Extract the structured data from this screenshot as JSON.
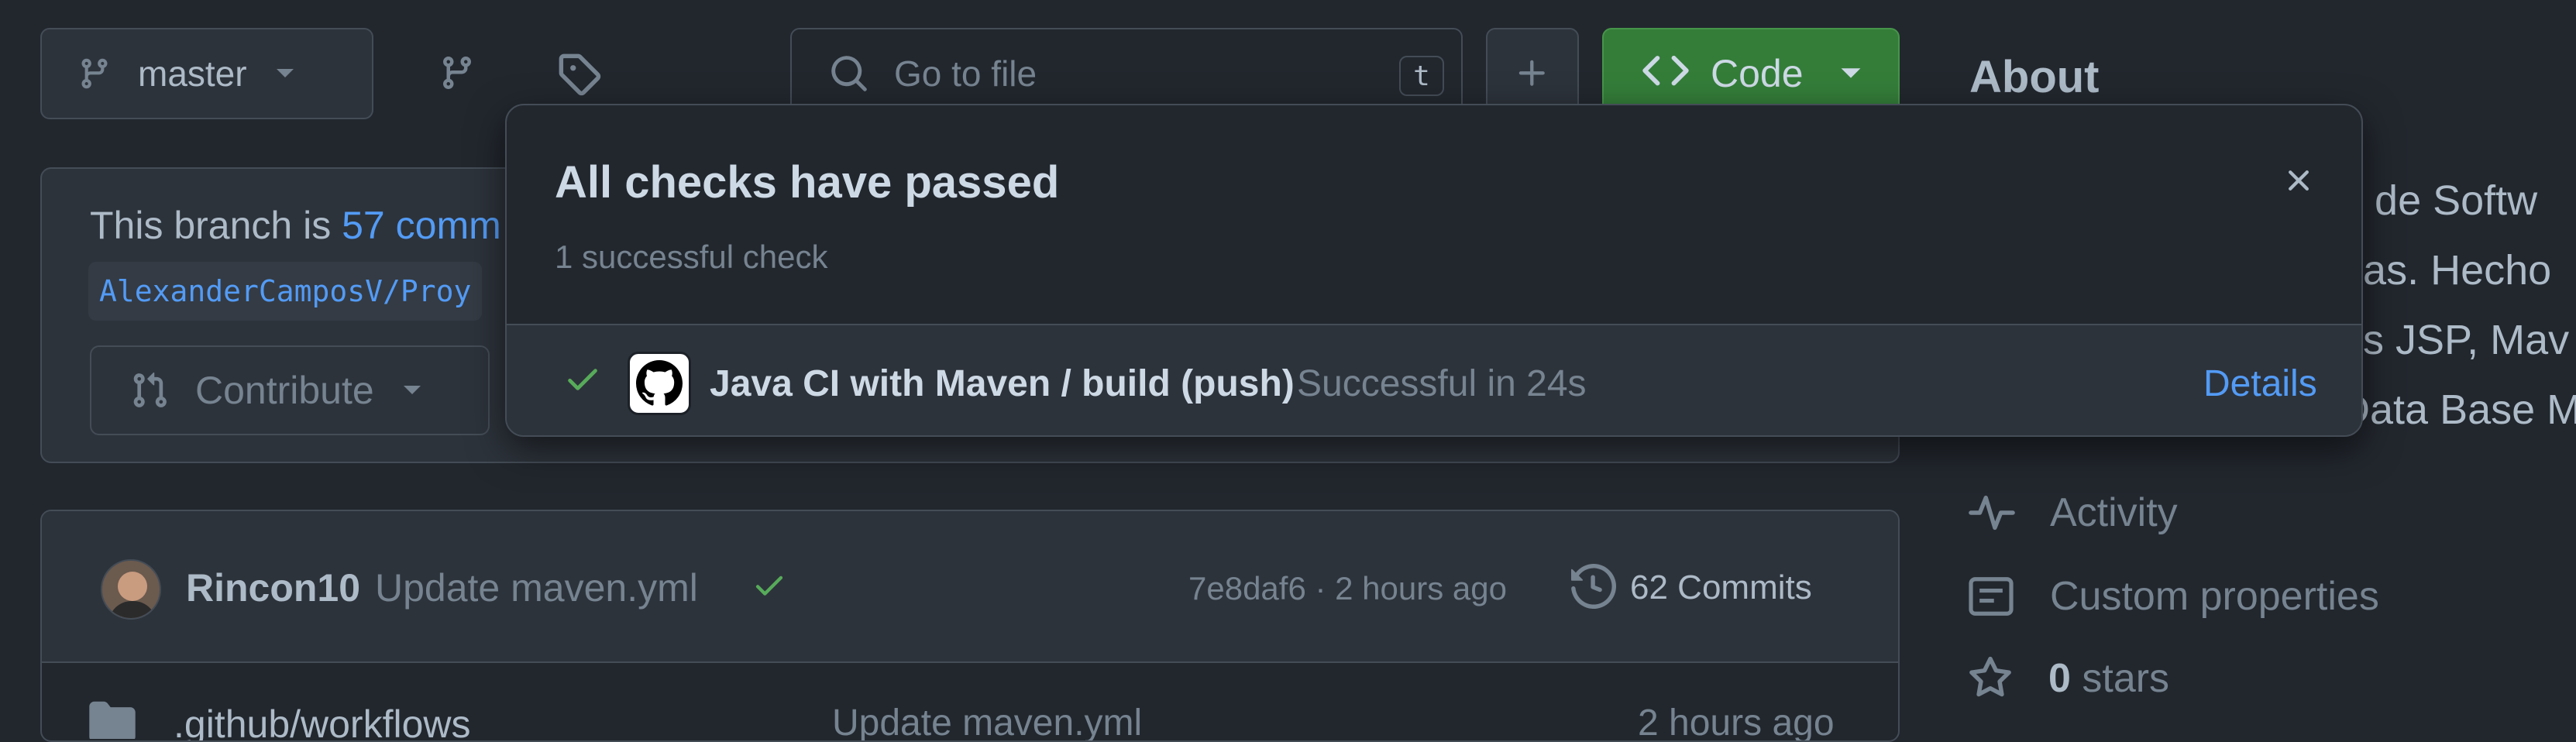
{
  "toolbar": {
    "branch_name": "master",
    "search_placeholder": "Go to file",
    "search_shortcut": "t",
    "code_label": "Code"
  },
  "branch_info": {
    "prefix": "This branch is ",
    "commits_link": "57 comm",
    "repo_ref": "AlexanderCamposV/Proy",
    "contribute_label": "Contribute"
  },
  "commit_bar": {
    "author": "Rincon10",
    "message": "Update maven.yml",
    "hash_time": "7e8daf6 · 2 hours ago",
    "commits_count": "62 Commits"
  },
  "file_row": {
    "name": ".github/workflows",
    "message": "Update maven.yml",
    "time": "2 hours ago"
  },
  "about": {
    "title": "About",
    "description_lines": [
      "o de Softw",
      "das. Hecho",
      "os JSP, Mav",
      "Data Base M"
    ],
    "activity": "Activity",
    "custom_properties": "Custom properties",
    "stars_count": "0",
    "stars_label": " stars"
  },
  "checks_popup": {
    "title": "All checks have passed",
    "subtitle": "1 successful check",
    "check_name": "Java CI with Maven / build (push)",
    "check_status": "Successful in 24s",
    "details_label": "Details"
  },
  "colors": {
    "background": "#22272e",
    "accent_link": "#539bf5",
    "success": "#57ab5a",
    "code_button": "#347d39"
  }
}
